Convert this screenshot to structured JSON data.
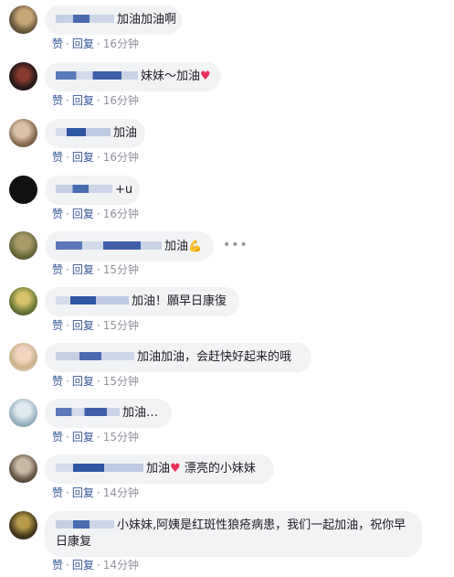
{
  "comments": [
    {
      "text": "加油加油啊",
      "like": "赞",
      "reply": "回复",
      "time": "16分钟"
    },
    {
      "text": "妹妹～加油",
      "heart": "♥",
      "like": "赞",
      "reply": "回复",
      "time": "16分钟"
    },
    {
      "text": "加油",
      "like": "赞",
      "reply": "回复",
      "time": "16分钟"
    },
    {
      "text": "+u",
      "like": "赞",
      "reply": "回复",
      "time": "16分钟"
    },
    {
      "text": "加油",
      "emoji": "💪",
      "more": "•••",
      "like": "赞",
      "reply": "回复",
      "time": "15分钟"
    },
    {
      "text": "加油！願早日康復",
      "like": "赞",
      "reply": "回复",
      "time": "15分钟"
    },
    {
      "text": "加油加油，会赶快好起来的哦",
      "like": "赞",
      "reply": "回复",
      "time": "15分钟"
    },
    {
      "text": "加油…",
      "like": "赞",
      "reply": "回复",
      "time": "15分钟"
    },
    {
      "text": "加油",
      "heart": "♥",
      "text2": "漂亮的小妹妹",
      "like": "赞",
      "reply": "回复",
      "time": "14分钟"
    },
    {
      "text": "小妹妹,阿姨是红斑性狼疮病患，我们一起加油，祝你早日康复",
      "like": "赞",
      "reply": "回复",
      "time": "14分钟"
    }
  ],
  "colors": {
    "link": "#385898",
    "bubble": "#f2f3f5",
    "muted": "#90949c",
    "heart": "#e8315b"
  }
}
